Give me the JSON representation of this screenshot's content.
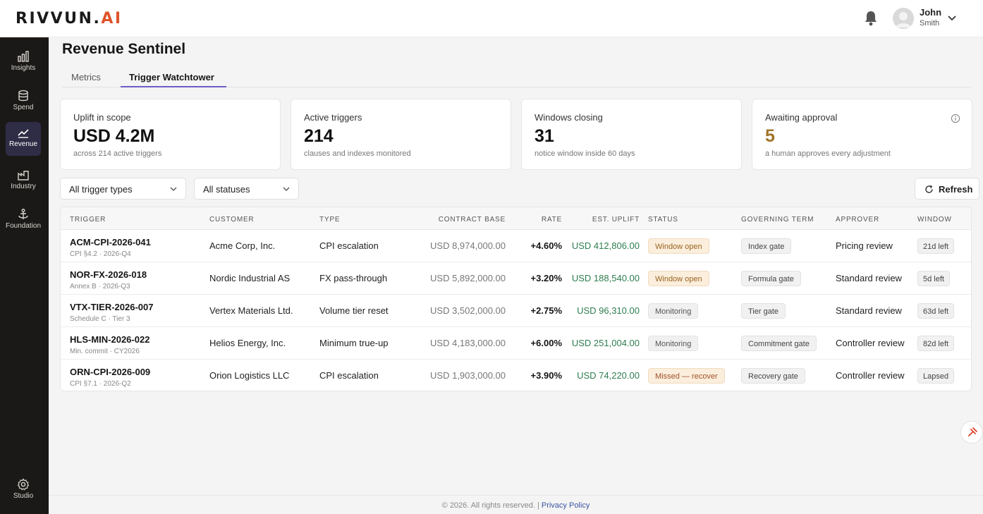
{
  "app": {
    "logo_main": "RIVVUN.",
    "logo_accent": "AI"
  },
  "user": {
    "name": "John",
    "sub": "Smith"
  },
  "sidebar": {
    "items": [
      {
        "label": "Insights",
        "icon": "bar-chart-icon"
      },
      {
        "label": "Spend",
        "icon": "database-icon"
      },
      {
        "label": "Revenue",
        "icon": "trend-line-icon"
      },
      {
        "label": "Industry",
        "icon": "factory-icon"
      },
      {
        "label": "Foundation",
        "icon": "anchor-icon"
      }
    ],
    "bottom": {
      "label": "Studio",
      "icon": "gear-icon"
    }
  },
  "page": {
    "title": "Revenue Sentinel"
  },
  "tabs": [
    {
      "label": "Metrics"
    },
    {
      "label": "Trigger Watchtower"
    }
  ],
  "cards": [
    {
      "label": "Uplift in scope",
      "value": "USD 4.2M",
      "sub": "across 214 active triggers"
    },
    {
      "label": "Active triggers",
      "value": "214",
      "sub": "clauses and indexes monitored"
    },
    {
      "label": "Windows closing",
      "value": "31",
      "sub": "notice window inside 60 days"
    },
    {
      "label": "Awaiting approval",
      "value": "5",
      "sub": "a human approves every adjustment"
    }
  ],
  "filters": {
    "types": "All trigger types",
    "statuses": "All statuses",
    "refresh": "Refresh"
  },
  "table": {
    "headers": {
      "trigger": "TRIGGER",
      "customer": "CUSTOMER",
      "type": "TYPE",
      "base": "CONTRACT BASE",
      "rate": "RATE",
      "uplift": "EST. UPLIFT",
      "status": "STATUS",
      "term": "GOVERNING TERM",
      "approver": "APPROVER",
      "window": "WINDOW"
    },
    "rows": [
      {
        "id": "ACM-CPI-2026-041",
        "sub": "CPI §4.2 · 2026-Q4",
        "customer": "Acme Corp, Inc.",
        "type": "CPI escalation",
        "base": "USD 8,974,000.00",
        "rate": "+4.60%",
        "uplift": "USD 412,806.00",
        "status": "Window open",
        "term": "Index gate",
        "approver": "Pricing review",
        "window": "21d left"
      },
      {
        "id": "NOR-FX-2026-018",
        "sub": "Annex B · 2026-Q3",
        "customer": "Nordic Industrial AS",
        "type": "FX pass-through",
        "base": "USD 5,892,000.00",
        "rate": "+3.20%",
        "uplift": "USD 188,540.00",
        "status": "Window open",
        "term": "Formula gate",
        "approver": "Standard review",
        "window": "5d left"
      },
      {
        "id": "VTX-TIER-2026-007",
        "sub": "Schedule C · Tier 3",
        "customer": "Vertex Materials Ltd.",
        "type": "Volume tier reset",
        "base": "USD 3,502,000.00",
        "rate": "+2.75%",
        "uplift": "USD 96,310.00",
        "status": "Monitoring",
        "term": "Tier gate",
        "approver": "Standard review",
        "window": "63d left"
      },
      {
        "id": "HLS-MIN-2026-022",
        "sub": "Min. commit · CY2026",
        "customer": "Helios Energy, Inc.",
        "type": "Minimum true-up",
        "base": "USD 4,183,000.00",
        "rate": "+6.00%",
        "uplift": "USD 251,004.00",
        "status": "Monitoring",
        "term": "Commitment gate",
        "approver": "Controller review",
        "window": "82d left"
      },
      {
        "id": "ORN-CPI-2026-009",
        "sub": "CPI §7.1 · 2026-Q2",
        "customer": "Orion Logistics LLC",
        "type": "CPI escalation",
        "base": "USD 1,903,000.00",
        "rate": "+3.90%",
        "uplift": "USD 74,220.00",
        "status": "Missed — recover",
        "term": "Recovery gate",
        "approver": "Controller review",
        "window": "Lapsed"
      }
    ]
  },
  "footer": {
    "copyright": "© 2026. All rights reserved. |",
    "privacy": "Privacy Policy"
  }
}
